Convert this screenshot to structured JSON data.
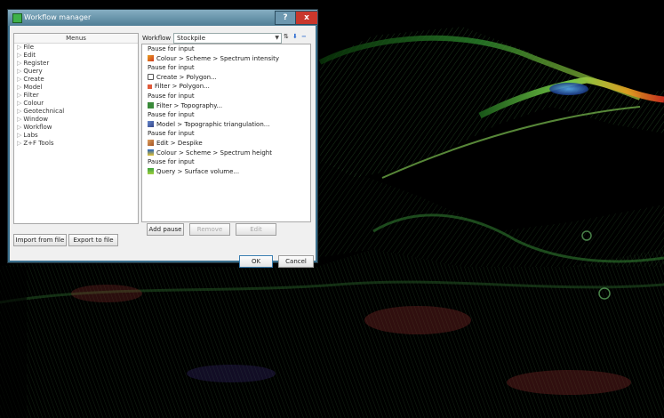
{
  "window": {
    "title": "Workflow manager",
    "help_label": "?",
    "close_label": "x"
  },
  "menus": {
    "header": "Menus",
    "items": [
      {
        "label": "File"
      },
      {
        "label": "Edit"
      },
      {
        "label": "Register"
      },
      {
        "label": "Query"
      },
      {
        "label": "Create"
      },
      {
        "label": "Model"
      },
      {
        "label": "Filter"
      },
      {
        "label": "Colour"
      },
      {
        "label": "Geotechnical"
      },
      {
        "label": "Window"
      },
      {
        "label": "Workflow"
      },
      {
        "label": "Labs"
      },
      {
        "label": "Z+F Tools"
      }
    ]
  },
  "workflow": {
    "label": "Workflow",
    "selected": "Stockpile",
    "steps": [
      {
        "text": "Pause for input",
        "icon": "none"
      },
      {
        "text": "Colour > Scheme > Spectrum intensity",
        "icon": "colour-scheme-icon"
      },
      {
        "text": "Pause for input",
        "icon": "none"
      },
      {
        "text": "Create > Polygon...",
        "icon": "create-polygon-icon"
      },
      {
        "text": "Filter > Polygon...",
        "icon": "filter-polygon-icon"
      },
      {
        "text": "Pause for input",
        "icon": "none"
      },
      {
        "text": "Filter > Topography...",
        "icon": "filter-topography-icon"
      },
      {
        "text": "Pause for input",
        "icon": "none"
      },
      {
        "text": "Model > Topographic triangulation...",
        "icon": "model-triangulation-icon"
      },
      {
        "text": "Pause for input",
        "icon": "none"
      },
      {
        "text": "Edit > Despike",
        "icon": "edit-despike-icon"
      },
      {
        "text": "Colour > Scheme > Spectrum height",
        "icon": "colour-height-icon"
      },
      {
        "text": "Pause for input",
        "icon": "none"
      },
      {
        "text": "Query > Surface volume...",
        "icon": "query-volume-icon"
      }
    ],
    "add_pause": "Add pause",
    "remove": "Remove",
    "edit": "Edit"
  },
  "footer": {
    "import": "Import from file",
    "export": "Export to file",
    "ok": "OK",
    "cancel": "Cancel"
  }
}
